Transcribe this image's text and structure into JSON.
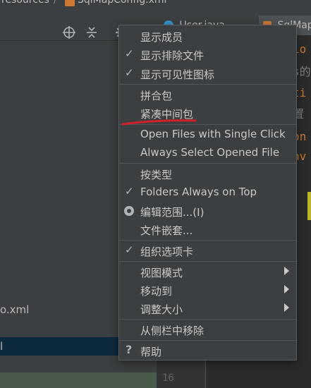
{
  "breadcrumb": {
    "folder": "resources",
    "separator": "/",
    "file": "SqlMapConfig.xml"
  },
  "project_toolbar": {
    "icons": [
      "target-icon",
      "collapse-icon",
      "gear-icon",
      "minimize-icon"
    ]
  },
  "tree": {
    "file_partial": "o.xml",
    "selected_partial": "l"
  },
  "tabs": [
    {
      "label": "User.java",
      "icon": "class-icon"
    },
    {
      "label": "SqlMap",
      "icon": "xml-icon"
    }
  ],
  "editor": {
    "code_fragments": [
      "io",
      "s的",
      "ti",
      "置",
      "on",
      "nv"
    ],
    "line_numbers": [
      "16"
    ]
  },
  "menu": {
    "items": [
      {
        "label": "显示成员",
        "checked": false
      },
      {
        "label": "显示排除文件",
        "checked": true
      },
      {
        "label": "显示可见性图标",
        "checked": true
      },
      {
        "label": "拼合包",
        "checked": false
      },
      {
        "label": "紧凑中间包",
        "checked": false
      },
      {
        "label": "Open Files with Single Click",
        "checked": false
      },
      {
        "label": "Always Select Opened File",
        "checked": false
      },
      {
        "label": "按类型",
        "checked": false
      },
      {
        "label": "Folders Always on Top",
        "checked": true
      },
      {
        "label": "编辑范围...(I)",
        "radio": true
      },
      {
        "label": "文件嵌套...",
        "checked": false
      },
      {
        "label": "组织选项卡",
        "checked": true
      },
      {
        "label": "视图模式",
        "submenu": true
      },
      {
        "label": "移动到",
        "submenu": true
      },
      {
        "label": "调整大小",
        "submenu": true
      },
      {
        "label": "从侧栏中移除",
        "checked": false
      },
      {
        "label": "帮助",
        "help": true
      }
    ]
  },
  "colors": {
    "menu_bg": "#3c3f41",
    "annotation_red": "#d2202a",
    "selection": "#0d293e"
  }
}
